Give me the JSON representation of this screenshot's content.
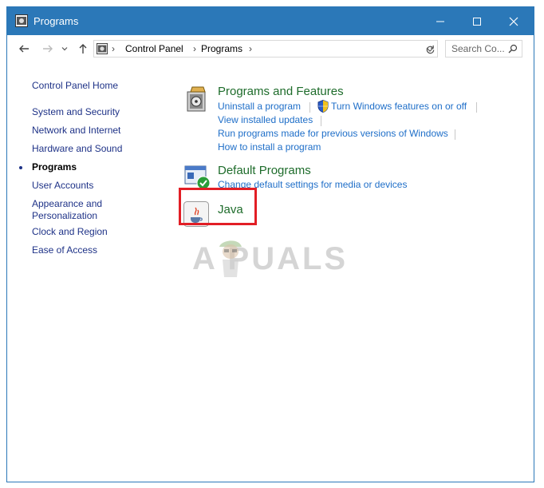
{
  "window": {
    "title": "Programs",
    "title_icon": "control-panel-icon",
    "minimize_icon": "minimize-icon",
    "maximize_icon": "maximize-icon",
    "close_icon": "close-icon"
  },
  "address": {
    "crumbs": [
      "Control Panel",
      "Programs"
    ],
    "search_placeholder": "Search Co..."
  },
  "sidebar": {
    "home": "Control Panel Home",
    "items": [
      {
        "label": "System and Security",
        "active": false
      },
      {
        "label": "Network and Internet",
        "active": false
      },
      {
        "label": "Hardware and Sound",
        "active": false
      },
      {
        "label": "Programs",
        "active": true
      },
      {
        "label": "User Accounts",
        "active": false
      },
      {
        "label": "Appearance and Personalization",
        "active": false
      },
      {
        "label": "Clock and Region",
        "active": false
      },
      {
        "label": "Ease of Access",
        "active": false
      }
    ]
  },
  "categories": {
    "programs_features": {
      "title": "Programs and Features",
      "links": [
        "Uninstall a program",
        "Turn Windows features on or off",
        "View installed updates",
        "Run programs made for previous versions of Windows",
        "How to install a program"
      ]
    },
    "default_programs": {
      "title": "Default Programs",
      "links": [
        "Change default settings for media or devices"
      ]
    },
    "java": {
      "title": "Java"
    }
  },
  "watermark": {
    "text": "A  PUALS"
  },
  "colors": {
    "titlebar": "#2b78b8",
    "link": "#1e6ec8",
    "category_title": "#1e6c2b",
    "highlight": "#e21e25"
  }
}
